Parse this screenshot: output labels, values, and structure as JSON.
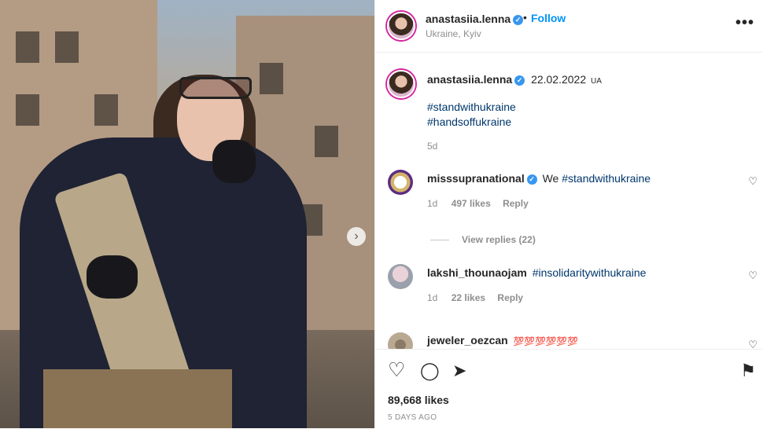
{
  "post": {
    "username": "anastasiia.lenna",
    "follow_label": "Follow",
    "separator": "•",
    "location": "Ukraine, Kyiv",
    "more_label": "•••",
    "next_label": "›"
  },
  "caption": {
    "username": "anastasiia.lenna",
    "date": "22.02.2022",
    "date_suffix": "UA",
    "hashtag1": "#standwithukraine",
    "hashtag2": "#handsoffukraine",
    "time_ago": "5d"
  },
  "comments": [
    {
      "username": "misssupranational",
      "text": "We",
      "tag": "#standwithukraine",
      "time": "1d",
      "likes": "497 likes",
      "reply": "Reply"
    },
    {
      "username": "lakshi_thounaojam",
      "text": "",
      "tag": "#insolidaritywithukraine",
      "time": "1d",
      "likes": "22 likes",
      "reply": "Reply"
    },
    {
      "username": "jeweler_oezcan",
      "text": "💯💯💯💯💯💯"
    }
  ],
  "view_replies": "View replies (22)",
  "actions": {
    "heart": "♡",
    "comment": "◯",
    "share": "➤",
    "save": "⚑"
  },
  "likes": "89,668 likes",
  "posted_ago": "5 DAYS AGO",
  "colors": {
    "link": "#0095f6",
    "hashtag": "#00376b",
    "muted": "#8e8e8e"
  }
}
